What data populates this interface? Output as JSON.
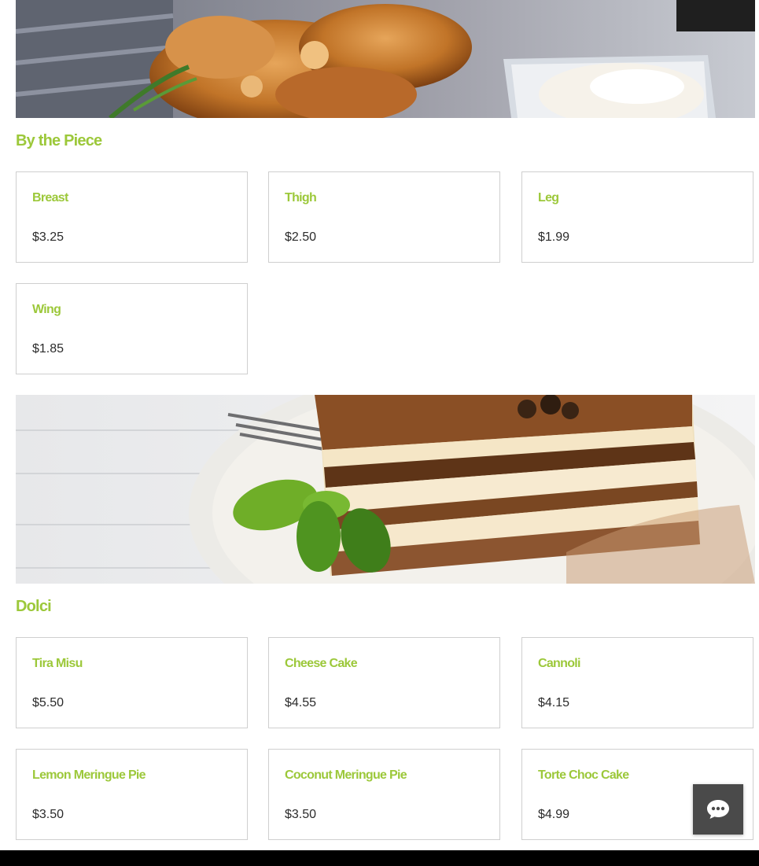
{
  "colors": {
    "accent": "#9cc83a",
    "price_text": "#2b2b2b",
    "card_border": "#cfcfcf",
    "chat_button": "#4a4a4a",
    "footer": "#000000"
  },
  "sections": [
    {
      "title": "By the Piece",
      "banner_image": "fried-chicken-photo",
      "items": [
        {
          "name": "Breast",
          "price": "$3.25"
        },
        {
          "name": "Thigh",
          "price": "$2.50"
        },
        {
          "name": "Leg",
          "price": "$1.99"
        },
        {
          "name": "Wing",
          "price": "$1.85"
        }
      ]
    },
    {
      "title": "Dolci",
      "banner_image": "tiramisu-photo",
      "items": [
        {
          "name": "Tira Misu",
          "price": "$5.50"
        },
        {
          "name": "Cheese Cake",
          "price": "$4.55"
        },
        {
          "name": "Cannoli",
          "price": "$4.15"
        },
        {
          "name": "Lemon Meringue Pie",
          "price": "$3.50"
        },
        {
          "name": "Coconut Meringue Pie",
          "price": "$3.50"
        },
        {
          "name": "Torte Choc Cake",
          "price": "$4.99"
        }
      ]
    }
  ],
  "chat_widget": {
    "icon": "chat-bubble-icon"
  }
}
